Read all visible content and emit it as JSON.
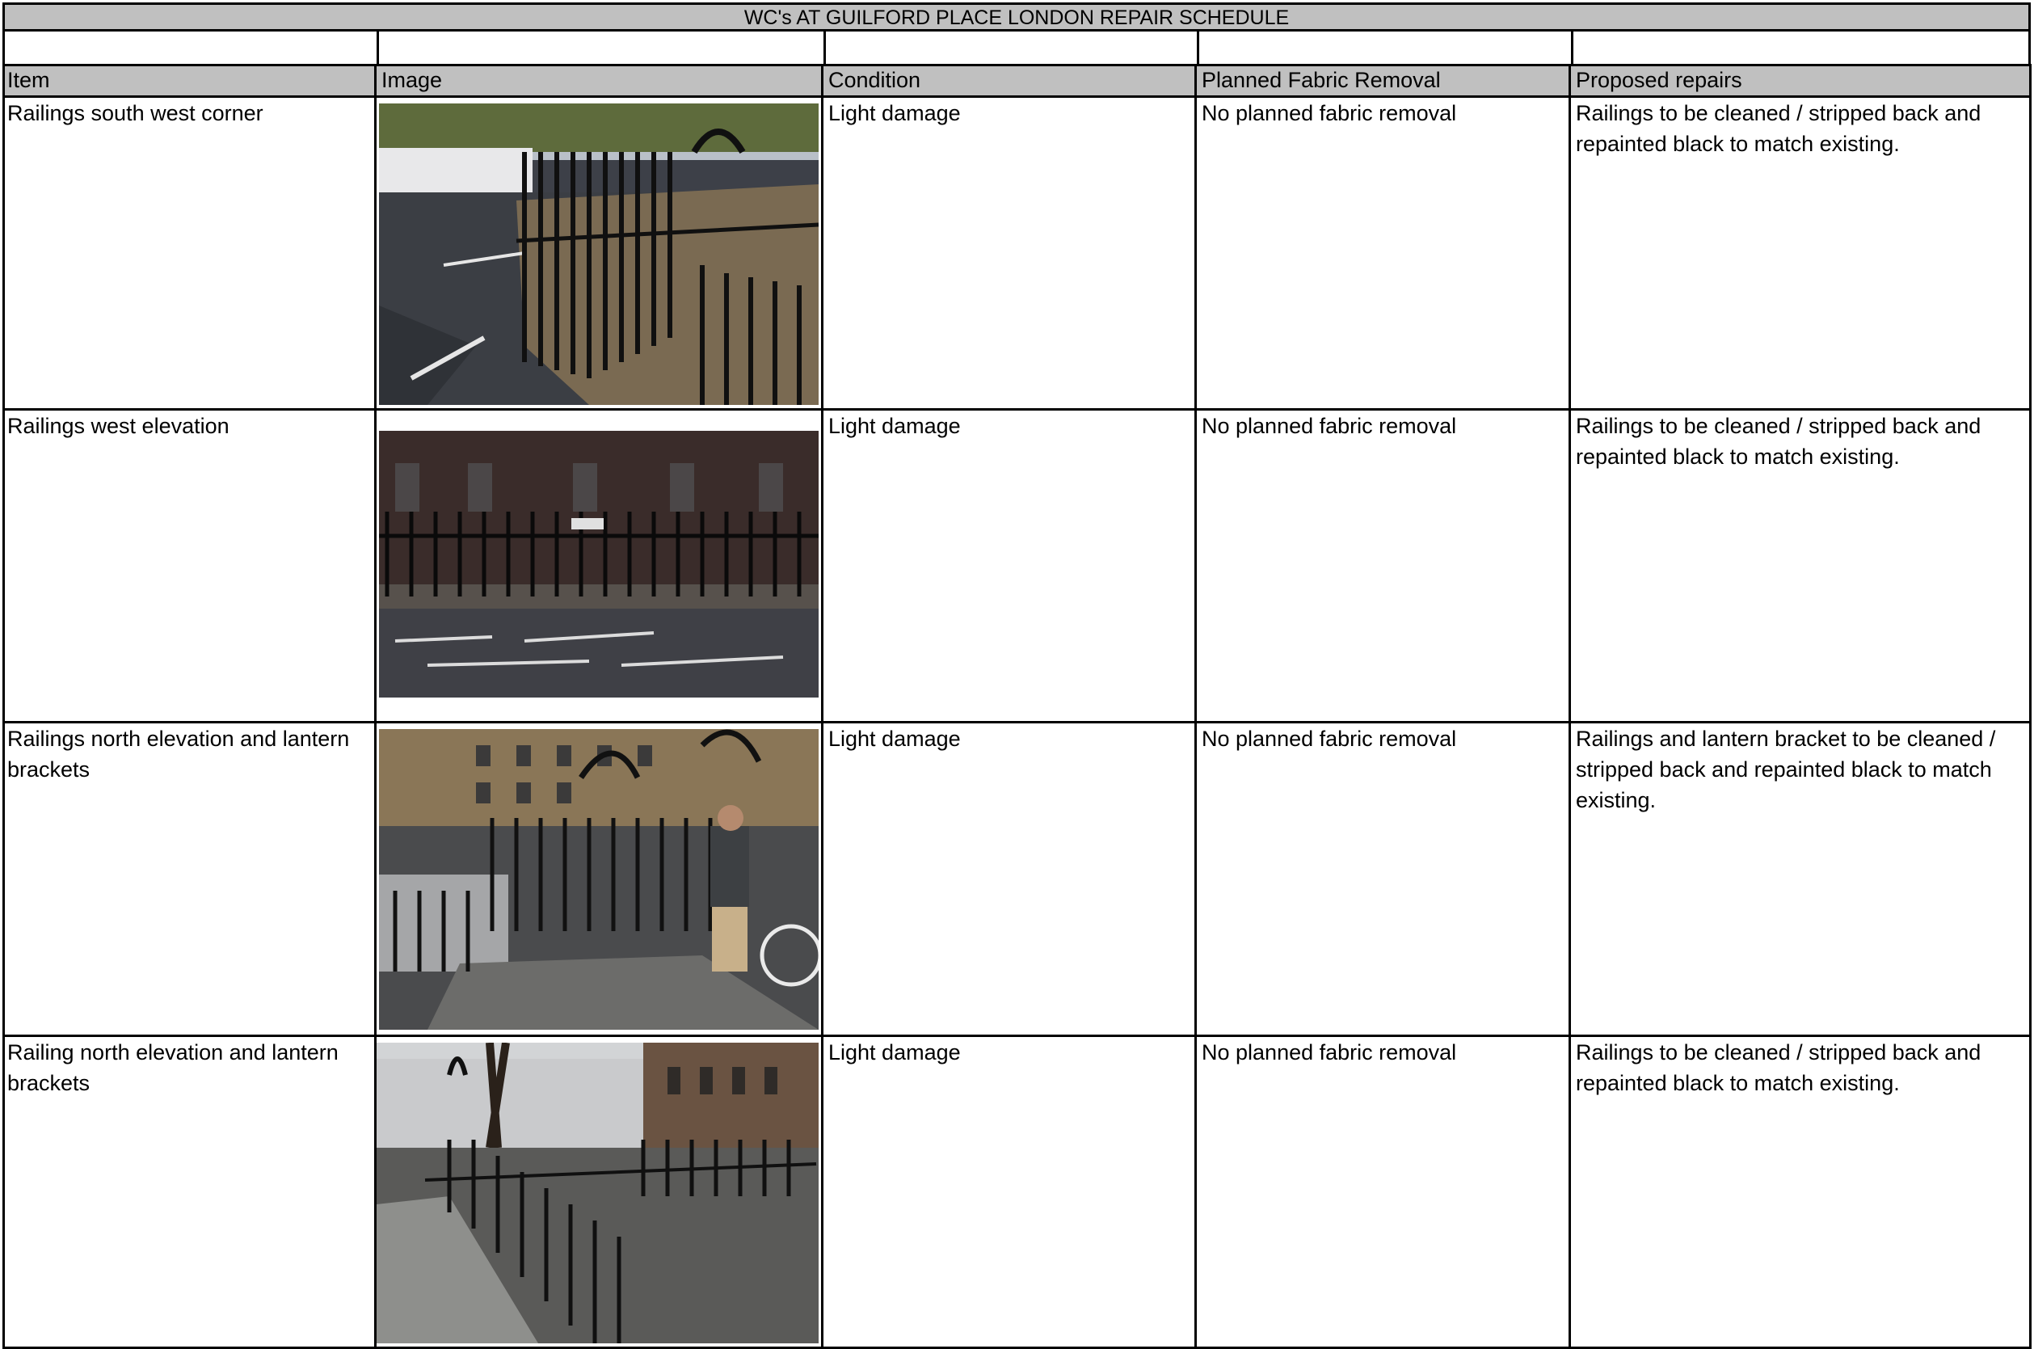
{
  "schedule": {
    "title": "WC's AT GUILFORD PLACE LONDON REPAIR SCHEDULE",
    "columns": {
      "item": "Item",
      "image": "Image",
      "condition": "Condition",
      "removal": "Planned Fabric Removal",
      "repairs": "Proposed repairs"
    },
    "rows": [
      {
        "item": "Railings south west corner",
        "image_subject": "railings-south-west-corner-photo",
        "condition": "Light damage",
        "removal": "No planned fabric removal",
        "repairs": "Railings to be cleaned / stripped back and repainted black to match existing."
      },
      {
        "item": "Railings west elevation",
        "image_subject": "railings-west-elevation-photo",
        "condition": "Light damage",
        "removal": "No planned fabric removal",
        "repairs": "Railings to be cleaned / stripped back and repainted black to match existing."
      },
      {
        "item": "Railings north elevation and lantern brackets",
        "image_subject": "railings-north-elevation-photo",
        "condition": "Light damage",
        "removal": "No planned fabric removal",
        "repairs": "Railings and lantern bracket to be cleaned / stripped back and repainted black to match existing."
      },
      {
        "item": "Railing north elevation and lantern brackets",
        "image_subject": "railing-north-elevation-lantern-photo",
        "condition": "Light damage",
        "removal": "No planned fabric removal",
        "repairs": "Railings to be cleaned / stripped back and repainted black to match existing."
      }
    ]
  },
  "colors": {
    "header_fill": "#c0c0c0",
    "grid_line": "#000000"
  }
}
